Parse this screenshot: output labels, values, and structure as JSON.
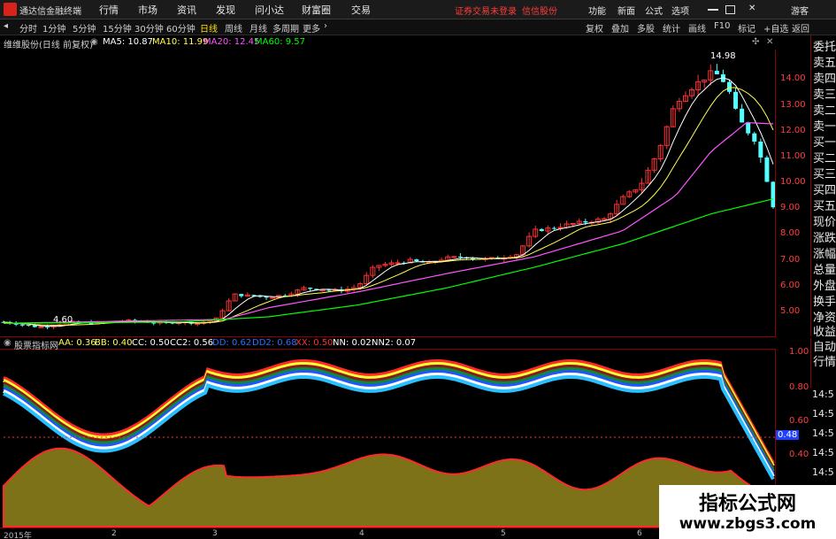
{
  "menubar": {
    "app_name": "通达信金融终端",
    "items": [
      "行情",
      "市场",
      "资讯",
      "发现",
      "问小达",
      "财富圈",
      "交易"
    ],
    "warning": "证券交易未登录",
    "broker": "信信股份",
    "right_items": [
      "功能",
      "新面",
      "公式",
      "选项"
    ],
    "guest": "游客"
  },
  "periodbar": {
    "items": [
      "分时",
      "1分钟",
      "5分钟",
      "15分钟",
      "30分钟",
      "60分钟",
      "日线",
      "周线",
      "月线",
      "多周期",
      "更多"
    ],
    "active": "日线",
    "right_items": [
      "复权",
      "叠加",
      "多股",
      "统计",
      "画线",
      "F10",
      "标记",
      "+自选",
      "返回"
    ]
  },
  "stock": {
    "title": "维维股份(日线 前复权)",
    "ma5": "MA5: 10.87",
    "ma10": "MA10: 11.99",
    "ma20": "MA20: 12.45",
    "ma60": "MA60: 9.57",
    "high_label": "14.98",
    "low_label": "4.60"
  },
  "price_scale": [
    "14.00",
    "13.00",
    "12.00",
    "11.00",
    "10.00",
    "9.00",
    "8.00",
    "7.00",
    "6.00",
    "5.00"
  ],
  "right_panel": [
    "委托",
    "卖五",
    "卖四",
    "卖三",
    "卖二",
    "卖一",
    "买一",
    "买二",
    "买三",
    "买四",
    "买五",
    "现价",
    "涨跌",
    "涨幅",
    "总量",
    "外盘",
    "换手",
    "净资",
    "收益"
  ],
  "right_panel2": [
    "自动",
    "行情",
    "14:5",
    "14:5",
    "14:5",
    "14:5",
    "14:5"
  ],
  "indicator": {
    "name": "股票指标网",
    "aa": "AA: 0.36",
    "bb": "BB: 0.40",
    "cc": "CC: 0.50",
    "cc2": "CC2: 0.56",
    "dd": "DD: 0.62",
    "dd2": "DD2: 0.68",
    "xx": "XX: 0.50",
    "nn": "NN: 0.02",
    "nn2": "NN2: 0.07",
    "current": "0.48"
  },
  "indicator_scale": [
    "1.00",
    "0.80",
    "0.60",
    "0.40"
  ],
  "dates": [
    "2015年",
    "2",
    "3",
    "4",
    "5",
    "6"
  ],
  "watermark": {
    "line1": "指标公式网",
    "line2": "www.zbgs3.com"
  },
  "colors": {
    "up": "#ff3232",
    "down": "#54ffff",
    "ma5": "#ffffff",
    "ma10": "#ffff55",
    "ma20": "#ff55ff",
    "ma60": "#00ff00",
    "accent": "#ffe000"
  },
  "chart_data": {
    "type": "candlestick",
    "ylim": [
      4.3,
      15.3
    ],
    "price_points": [
      [
        0,
        4.85
      ],
      [
        20,
        4.75
      ],
      [
        40,
        4.65
      ],
      [
        60,
        4.75
      ],
      [
        80,
        4.85
      ],
      [
        100,
        4.8
      ],
      [
        120,
        4.85
      ],
      [
        140,
        4.9
      ],
      [
        160,
        4.85
      ],
      [
        180,
        4.8
      ],
      [
        200,
        4.85
      ],
      [
        220,
        4.8
      ],
      [
        240,
        4.95
      ],
      [
        260,
        5.9
      ],
      [
        280,
        5.85
      ],
      [
        300,
        5.8
      ],
      [
        320,
        5.9
      ],
      [
        340,
        6.15
      ],
      [
        360,
        6.1
      ],
      [
        380,
        6.05
      ],
      [
        400,
        6.2
      ],
      [
        420,
        7.0
      ],
      [
        440,
        7.1
      ],
      [
        460,
        7.2
      ],
      [
        480,
        7.1
      ],
      [
        500,
        7.3
      ],
      [
        520,
        7.35
      ],
      [
        540,
        7.25
      ],
      [
        560,
        7.3
      ],
      [
        580,
        7.45
      ],
      [
        600,
        8.35
      ],
      [
        620,
        8.45
      ],
      [
        640,
        8.6
      ],
      [
        660,
        8.7
      ],
      [
        680,
        8.8
      ],
      [
        700,
        9.6
      ],
      [
        720,
        10.1
      ],
      [
        740,
        11.4
      ],
      [
        760,
        13.3
      ],
      [
        780,
        13.9
      ],
      [
        800,
        14.4
      ],
      [
        810,
        14.3
      ],
      [
        820,
        13.7
      ],
      [
        830,
        12.7
      ],
      [
        840,
        12.2
      ],
      [
        850,
        11.8
      ],
      [
        860,
        10.7
      ],
      [
        870,
        9.3
      ]
    ],
    "ma60_points": [
      [
        0,
        4.8
      ],
      [
        200,
        4.85
      ],
      [
        300,
        5.05
      ],
      [
        400,
        5.5
      ],
      [
        500,
        6.15
      ],
      [
        600,
        6.95
      ],
      [
        700,
        7.85
      ],
      [
        800,
        9.0
      ],
      [
        870,
        9.57
      ]
    ],
    "ma20_points": [
      [
        0,
        4.8
      ],
      [
        250,
        4.95
      ],
      [
        300,
        5.4
      ],
      [
        400,
        6.0
      ],
      [
        500,
        6.7
      ],
      [
        600,
        7.35
      ],
      [
        700,
        8.35
      ],
      [
        760,
        9.7
      ],
      [
        800,
        11.4
      ],
      [
        840,
        12.5
      ],
      [
        870,
        12.45
      ]
    ]
  }
}
